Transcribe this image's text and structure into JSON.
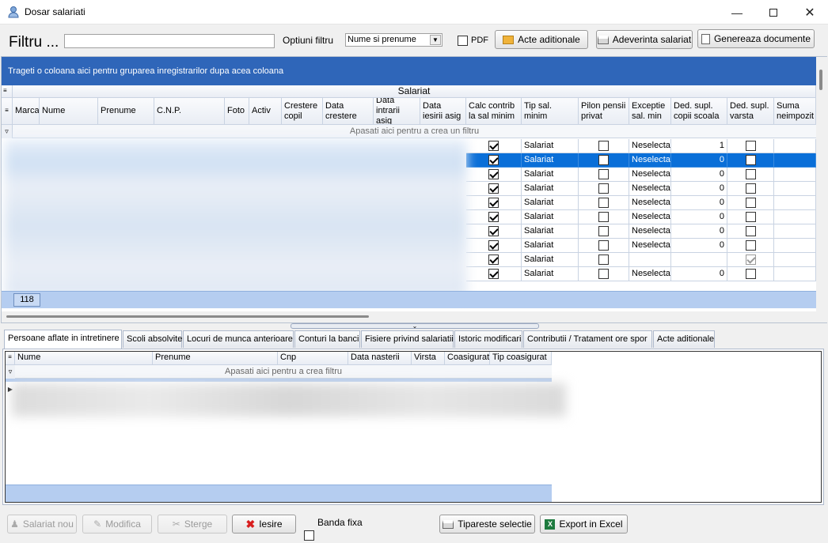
{
  "window": {
    "title": "Dosar salariati"
  },
  "filter": {
    "label": "Filtru ...",
    "input_value": "",
    "options_label": "Optiuni filtru",
    "options_selected": "Nume si prenume",
    "pdf_label": "PDF",
    "pdf_checked": false
  },
  "toolbar": {
    "acte": "Acte aditionale",
    "adeverinta": "Adeverinta salariat",
    "genereaza": "Genereaza documente"
  },
  "main_grid": {
    "group_hint": "Trageti o coloana aici pentru gruparea inregistrarilor dupa acea coloana",
    "band_title": "Salariat",
    "filter_hint": "Apasati aici pentru a crea un filtru",
    "record_count": "118",
    "columns": [
      "Marca",
      "Nume",
      "Prenume",
      "C.N.P.",
      "Foto",
      "Activ",
      "Crestere copil",
      "Data crestere",
      "Data intrarii asig",
      "Data iesirii asig",
      "Calc contrib la sal minim",
      "Tip sal. minim",
      "Pilon pensii privat",
      "Exceptie sal. min",
      "Ded. supl. copii scoala",
      "Ded. supl. varsta",
      "Suma neimpozit"
    ],
    "rows": [
      {
        "calc": true,
        "tip": "Salariat",
        "pilon": false,
        "exceptie": "Neselectat",
        "ded_copii": "1",
        "ded_varsta": false,
        "selected": false
      },
      {
        "calc": true,
        "tip": "Salariat",
        "pilon": false,
        "exceptie": "Neselectat",
        "ded_copii": "0",
        "ded_varsta": false,
        "selected": true
      },
      {
        "calc": true,
        "tip": "Salariat",
        "pilon": false,
        "exceptie": "Neselectat",
        "ded_copii": "0",
        "ded_varsta": false,
        "selected": false
      },
      {
        "calc": true,
        "tip": "Salariat",
        "pilon": false,
        "exceptie": "Neselectat",
        "ded_copii": "0",
        "ded_varsta": false,
        "selected": false
      },
      {
        "calc": true,
        "tip": "Salariat",
        "pilon": false,
        "exceptie": "Neselectat",
        "ded_copii": "0",
        "ded_varsta": false,
        "selected": false
      },
      {
        "calc": true,
        "tip": "Salariat",
        "pilon": false,
        "exceptie": "Neselectat",
        "ded_copii": "0",
        "ded_varsta": false,
        "selected": false
      },
      {
        "calc": true,
        "tip": "Salariat",
        "pilon": false,
        "exceptie": "Neselectat",
        "ded_copii": "0",
        "ded_varsta": false,
        "selected": false
      },
      {
        "calc": true,
        "tip": "Salariat",
        "pilon": false,
        "exceptie": "Neselectat",
        "ded_copii": "0",
        "ded_varsta": false,
        "selected": false
      },
      {
        "calc": true,
        "tip": "Salariat",
        "pilon": false,
        "exceptie": "",
        "ded_copii": "",
        "ded_varsta": true,
        "ded_varsta_grey": true,
        "selected": false
      },
      {
        "calc": true,
        "tip": "Salariat",
        "pilon": false,
        "exceptie": "Neselectat",
        "ded_copii": "0",
        "ded_varsta": false,
        "selected": false
      }
    ]
  },
  "tabs": [
    "Persoane aflate in intretinere",
    "Scoli absolvite",
    "Locuri de munca anterioare",
    "Conturi la banci",
    "Fisiere privind salariatii",
    "Istoric modificari",
    "Contributii / Tratament ore spor",
    "Acte aditionale"
  ],
  "sub_grid": {
    "columns": [
      "Nume",
      "Prenume",
      "Cnp",
      "Data nasterii",
      "Virsta",
      "Coasigurat",
      "Tip coasigurat"
    ],
    "filter_hint": "Apasati aici pentru a  crea filtru"
  },
  "bottom": {
    "salariat_nou": "Salariat nou",
    "modifica": "Modifica",
    "sterge": "Sterge",
    "iesire": "Iesire",
    "banda_fixa": "Banda fixa",
    "tipareste": "Tipareste selectie",
    "export": "Export in Excel"
  },
  "colors": {
    "accent": "#2f66b9",
    "selected_row": "#0a6fd8",
    "grid_footer": "#b5cdf0"
  }
}
